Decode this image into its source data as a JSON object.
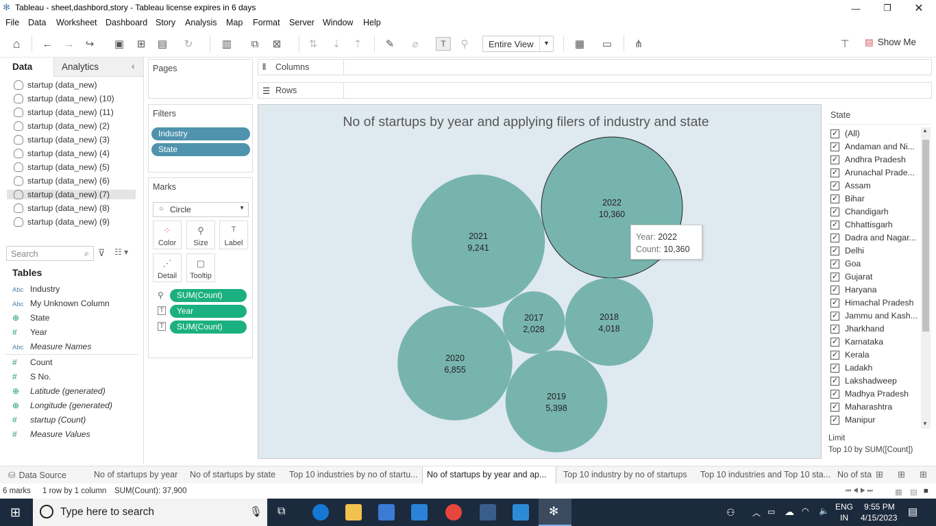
{
  "window": {
    "title": "Tableau - sheet,dashbord,story - Tableau license expires in 6 days"
  },
  "menu": [
    "File",
    "Data",
    "Worksheet",
    "Dashboard",
    "Story",
    "Analysis",
    "Map",
    "Format",
    "Server",
    "Window",
    "Help"
  ],
  "toolbar": {
    "fit": "Entire View",
    "show_me": "Show Me"
  },
  "left_tabs": {
    "data": "Data",
    "analytics": "Analytics"
  },
  "data_sources": [
    "startup (data_new)",
    "startup (data_new) (10)",
    "startup (data_new) (11)",
    "startup (data_new) (2)",
    "startup (data_new) (3)",
    "startup (data_new) (4)",
    "startup (data_new) (5)",
    "startup (data_new) (6)",
    "startup (data_new) (7)",
    "startup (data_new) (8)",
    "startup (data_new) (9)"
  ],
  "search_placeholder": "Search",
  "tables_heading": "Tables",
  "fields": [
    {
      "type": "Abc",
      "name": "Industry",
      "italic": false
    },
    {
      "type": "Abc",
      "name": "My Unknown Column",
      "italic": false
    },
    {
      "type": "globe",
      "name": "State",
      "italic": false
    },
    {
      "type": "#",
      "name": "Year",
      "italic": false
    },
    {
      "type": "Abc",
      "name": "Measure Names",
      "italic": true
    },
    {
      "type": "#",
      "name": "Count",
      "italic": false
    },
    {
      "type": "#",
      "name": "S No.",
      "italic": false
    },
    {
      "type": "globe",
      "name": "Latitude (generated)",
      "italic": true
    },
    {
      "type": "globe",
      "name": "Longitude (generated)",
      "italic": true
    },
    {
      "type": "#",
      "name": "startup (Count)",
      "italic": true
    },
    {
      "type": "#",
      "name": "Measure Values",
      "italic": true
    }
  ],
  "pages": {
    "label": "Pages"
  },
  "filters": {
    "label": "Filters",
    "pills": [
      "Industry",
      "State"
    ]
  },
  "marks": {
    "label": "Marks",
    "type": "Circle",
    "buttons": [
      "Color",
      "Size",
      "Label",
      "Detail",
      "Tooltip"
    ],
    "pills": [
      "SUM(Count)",
      "Year",
      "SUM(Count)"
    ]
  },
  "shelves": {
    "columns": "Columns",
    "rows": "Rows"
  },
  "viz": {
    "title": "No of startups by year  and applying filers of industry and state"
  },
  "chart_data": {
    "type": "packed bubble",
    "title": "No of startups by year  and applying filers of industry and state",
    "series": [
      {
        "name": "SUM(Count)",
        "points": [
          {
            "year": "2022",
            "count": 10360,
            "label": "10,360"
          },
          {
            "year": "2021",
            "count": 9241,
            "label": "9,241"
          },
          {
            "year": "2020",
            "count": 6855,
            "label": "6,855"
          },
          {
            "year": "2019",
            "count": 5398,
            "label": "5,398"
          },
          {
            "year": "2018",
            "count": 4018,
            "label": "4,018"
          },
          {
            "year": "2017",
            "count": 2028,
            "label": "2,028"
          }
        ]
      }
    ],
    "color": "#78b4ae"
  },
  "tooltip": {
    "year_key": "Year:",
    "year_val": "2022",
    "count_key": "Count:",
    "count_val": "10,360"
  },
  "state_filter": {
    "title": "State",
    "items": [
      "(All)",
      "Andaman and Ni...",
      "Andhra Pradesh",
      "Arunachal Prade...",
      "Assam",
      "Bihar",
      "Chandigarh",
      "Chhattisgarh",
      "Dadra and Nagar...",
      "Delhi",
      "Goa",
      "Gujarat",
      "Haryana",
      "Himachal Pradesh",
      "Jammu and Kash...",
      "Jharkhand",
      "Karnataka",
      "Kerala",
      "Ladakh",
      "Lakshadweep",
      "Madhya Pradesh",
      "Maharashtra",
      "Manipur"
    ],
    "limit_label": "Limit",
    "limit_value": "Top 10 by SUM([Count])"
  },
  "sheet_tabs": [
    "Data Source",
    "No of startups by year",
    "No of startups by state",
    "Top 10 industries by no of startu...",
    "No of startups by year  and ap...",
    "Top 10 industry by no of startups",
    "Top 10 industries and Top 10 sta...",
    "No of sta"
  ],
  "status": {
    "marks": "6 marks",
    "rows": "1 row by 1 column",
    "sum": "SUM(Count): 37,900"
  },
  "taskbar": {
    "search": "Type here to search",
    "lang": "ENG",
    "region": "IN",
    "time": "9:55 PM",
    "date": "4/15/2023"
  }
}
